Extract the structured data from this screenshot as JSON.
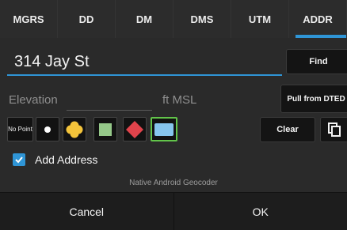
{
  "tabs": [
    {
      "label": "MGRS",
      "active": false
    },
    {
      "label": "DD",
      "active": false
    },
    {
      "label": "DM",
      "active": false
    },
    {
      "label": "DMS",
      "active": false
    },
    {
      "label": "UTM",
      "active": false
    },
    {
      "label": "ADDR",
      "active": true
    }
  ],
  "address": {
    "value": "314 Jay St",
    "find_label": "Find"
  },
  "elevation": {
    "label": "Elevation",
    "value": "",
    "unit": "ft MSL",
    "pull_label": "Pull from DTED"
  },
  "point_style": {
    "no_point_label": "No Point",
    "icons": [
      "dot-icon",
      "flower-icon",
      "square-icon",
      "diamond-icon",
      "rectangle-icon"
    ],
    "selected": "rectangle-icon",
    "colors": {
      "dot": "#ffffff",
      "flower": "#f4c43b",
      "square": "#95c889",
      "diamond": "#e0434b",
      "rectangle": "#86c5ed",
      "selected_border": "#62c44a"
    }
  },
  "actions": {
    "clear_label": "Clear"
  },
  "add_address": {
    "label": "Add Address",
    "checked": true
  },
  "geocoder_text": "Native Android Geocoder",
  "footer": {
    "cancel_label": "Cancel",
    "ok_label": "OK"
  },
  "accent_color": "#2f95d6"
}
